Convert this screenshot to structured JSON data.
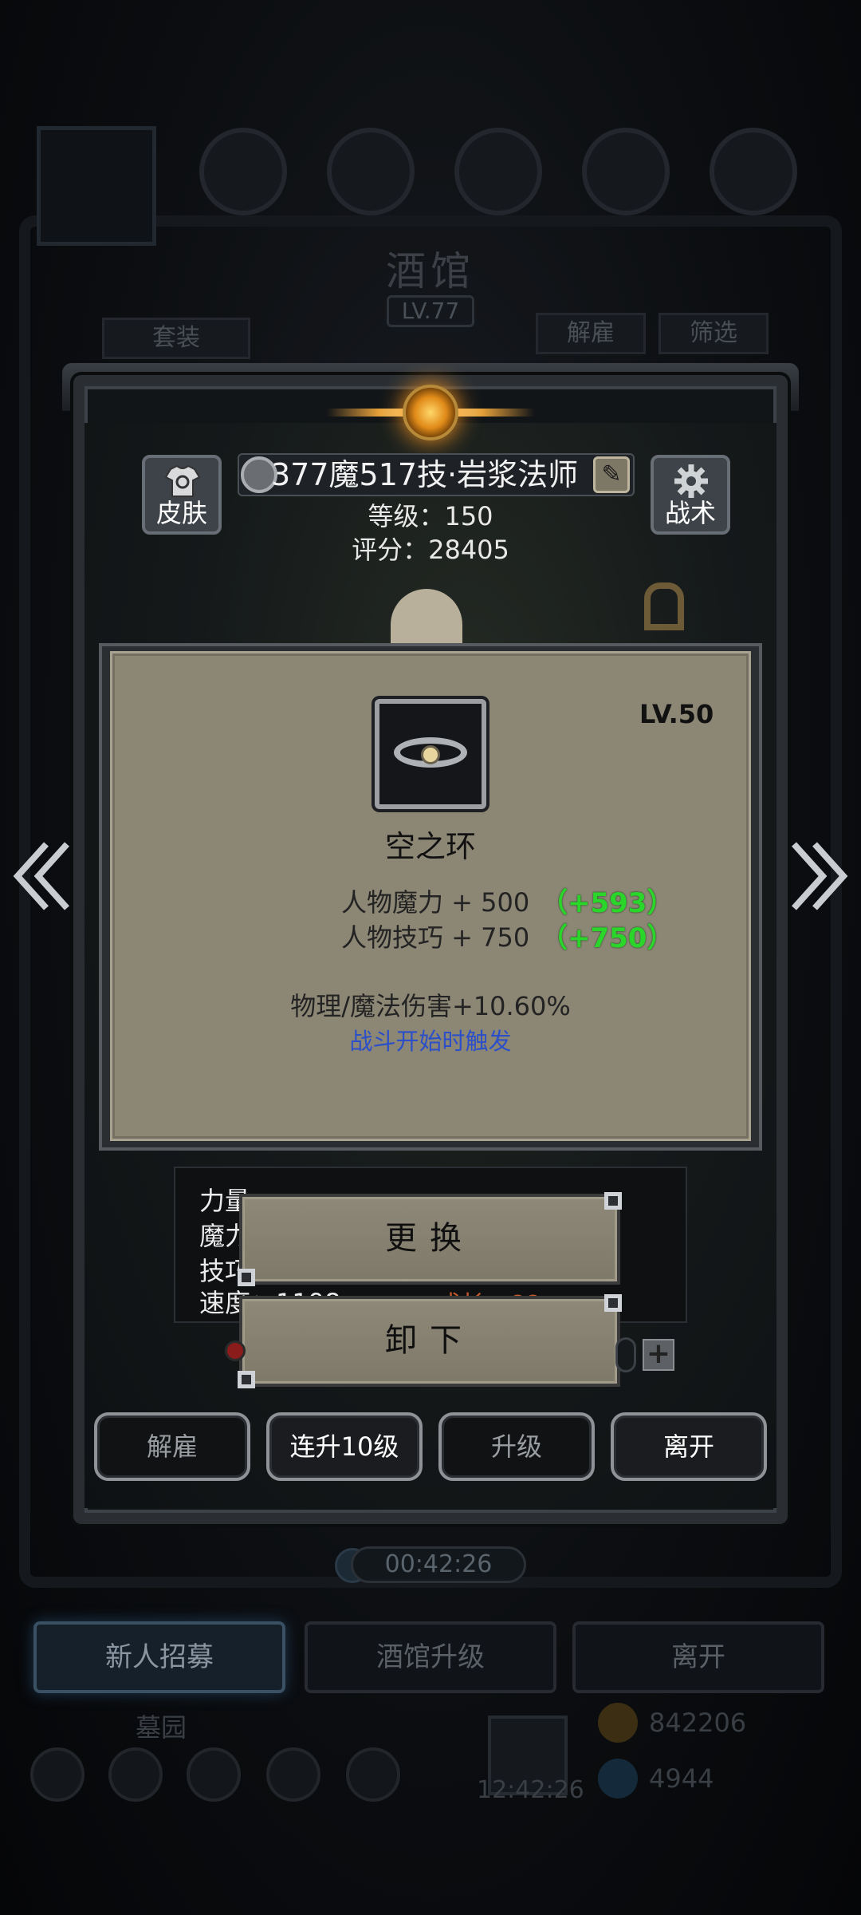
{
  "background": {
    "title": "酒馆",
    "level": "LV.77",
    "left_tab": "套装",
    "right_tabs": [
      "解雇",
      "筛选"
    ],
    "timer": "00:42:26",
    "bottom_tabs": [
      "新人招募",
      "酒馆升级",
      "离开"
    ],
    "graveyard_label": "墓园",
    "clock": "12:42:26",
    "gold": "842206",
    "gems": "4944"
  },
  "hero": {
    "name": "377魔517技·岩浆法师",
    "level_line": "等级：150",
    "score_line": "评分：28405",
    "skin_label": "皮肤",
    "tactics_label": "战术"
  },
  "item": {
    "level": "LV.50",
    "name": "空之环",
    "attributes": [
      {
        "text": "人物魔力 + 500",
        "bonus": "（+593）"
      },
      {
        "text": "人物技巧 + 750",
        "bonus": "（+750）"
      }
    ],
    "effect": "物理/魔法伤害+10.60%",
    "trigger": "战斗开始时触发"
  },
  "stats_partial": {
    "labels": [
      "力量",
      "魔力",
      "技巧",
      "速度：1198"
    ],
    "growth": "成长：66"
  },
  "menu": {
    "replace": "更换",
    "unequip": "卸下"
  },
  "actions": [
    "解雇",
    "连升10级",
    "升级",
    "离开"
  ],
  "colors": {
    "bonus_green": "#2bd62b",
    "trigger_blue": "#2b4fc9",
    "tooltip_bg": "#8c8675"
  },
  "icons": [
    "shirt-refresh-icon",
    "gear-icon",
    "gem-badge-icon",
    "edit-icon",
    "chevron-left-icon",
    "chevron-right-icon",
    "plus-icon"
  ]
}
